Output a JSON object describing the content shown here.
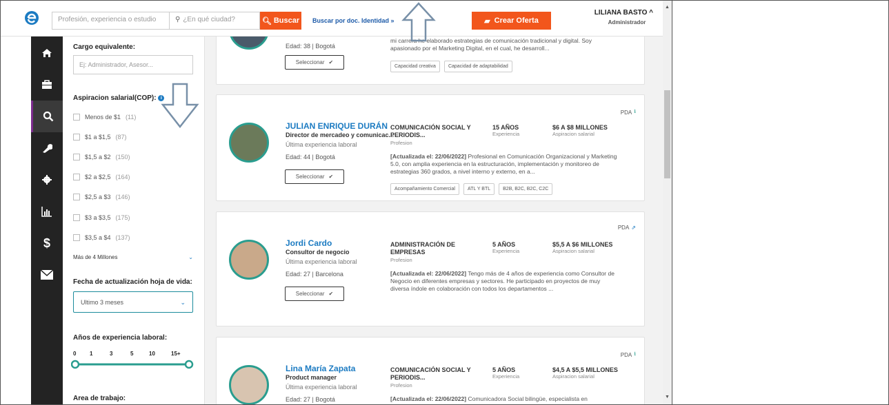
{
  "topbar": {
    "search_placeholder": "Profesión, experiencia o estudio",
    "city_placeholder": "¿En qué ciudad?",
    "search_button": "Buscar",
    "doc_link": "Buscar por doc. Identidad »",
    "create_button": "Crear Oferta",
    "user_name": "LILIANA BASTO",
    "user_role": "Administrador"
  },
  "sidebar": {
    "items": [
      "home-icon",
      "briefcase-icon",
      "search-icon",
      "wrench-icon",
      "gear-icon",
      "chart-icon",
      "dollar-icon",
      "mail-icon"
    ],
    "active": "search-icon"
  },
  "filters": {
    "cargo_label": "Cargo equivalente:",
    "cargo_placeholder": "Ej: Administrador, Asesor...",
    "salary_label": "Aspiracion salarial(COP):",
    "salary_options": [
      {
        "label": "Menos de $1",
        "count": "(11)"
      },
      {
        "label": "$1 a $1,5",
        "count": "(87)"
      },
      {
        "label": "$1,5 a $2",
        "count": "(150)"
      },
      {
        "label": "$2 a $2,5",
        "count": "(164)"
      },
      {
        "label": "$2,5 a $3",
        "count": "(146)"
      },
      {
        "label": "$3 a $3,5",
        "count": "(175)"
      },
      {
        "label": "$3,5 a $4",
        "count": "(137)"
      }
    ],
    "more_label": "Más de 4 Millones",
    "update_label": "Fecha de actualización hoja de vida:",
    "update_value": "Ultimo 3 meses",
    "experience_label": "Años de experiencia laboral:",
    "experience_ticks": [
      "0",
      "1",
      "3",
      "5",
      "10",
      "15+"
    ],
    "area_label": "Area de trabajo:"
  },
  "cards": [
    {
      "name": "",
      "role": "",
      "sub": "",
      "age": "Edad: 38 | Bogotá",
      "select": "Seleccionar",
      "desc": "mi carrera he elaborado estrategias de comunicación tradicional y digital. Soy apasionado por el Marketing Digital, en el cual, he desarroll...",
      "tags": [
        "Capacidad creativa",
        "Capacidad de adaptabilidad"
      ]
    },
    {
      "name": "JULIAN ENRIQUE DURÁN",
      "role": "Director de mercadeo y comunicac...",
      "sub": "Última experiencia laboral",
      "age": "Edad: 44 | Bogotá",
      "select": "Seleccionar",
      "prof": "COMUNICACIÓN SOCIAL Y PERIODIS...",
      "prof_sub": "Profesion",
      "exp": "15 AÑOS",
      "exp_sub": "Experiencia",
      "sal": "$6 A $8 MILLONES",
      "sal_sub": "Aspiracion salarial",
      "desc_date": "[Actualizada el: 22/06/2022]",
      "desc": "Profesional en Comunicación Organizacional y Marketing 5.0, con amplia experiencia en la estructuración, implementación y monitoreo de estrategias 360 grados, a nivel interno y externo, en a...",
      "tags": [
        "Acompañamiento Comercial",
        "ATL Y BTL",
        "B2B, B2C, B2C, C2C"
      ],
      "pda": "PDA"
    },
    {
      "name": "Jordi Cardo",
      "role": "Consultor de negocio",
      "sub": "Última experiencia laboral",
      "age": "Edad: 27 | Barcelona",
      "select": "Seleccionar",
      "prof": "ADMINISTRACIÓN DE EMPRESAS",
      "prof_sub": "Profesion",
      "exp": "5 AÑOS",
      "exp_sub": "Experiencia",
      "sal": "$5,5 A $6 MILLONES",
      "sal_sub": "Aspiracion salarial",
      "desc_date": "[Actualizada el: 22/06/2022]",
      "desc": "Tengo más de 4 años de experiencia como Consultor de Negocio en diferentes empresas y sectores. He participado en proyectos de muy diversa índole en colaboración con todos los departamentos ...",
      "pda": "PDA"
    },
    {
      "name": "Lina María Zapata",
      "role": "Product manager",
      "sub": "Última experiencia laboral",
      "age": "Edad: 27 | Bogotá",
      "prof": "COMUNICACIÓN SOCIAL Y PERIODIS...",
      "prof_sub": "Profesion",
      "exp": "5 AÑOS",
      "exp_sub": "Experiencia",
      "sal": "$4,5 A $5,5 MILLONES",
      "sal_sub": "Aspiracion salarial",
      "desc_date": "[Actualizada el: 22/06/2022]",
      "desc": "Comunicadora Social bilingüe, especialista en",
      "pda": "PDA"
    }
  ],
  "colors": {
    "accent": "#f2561c",
    "link": "#1c7bc2",
    "teal": "#2a9d8f",
    "sidebar": "#232323"
  }
}
